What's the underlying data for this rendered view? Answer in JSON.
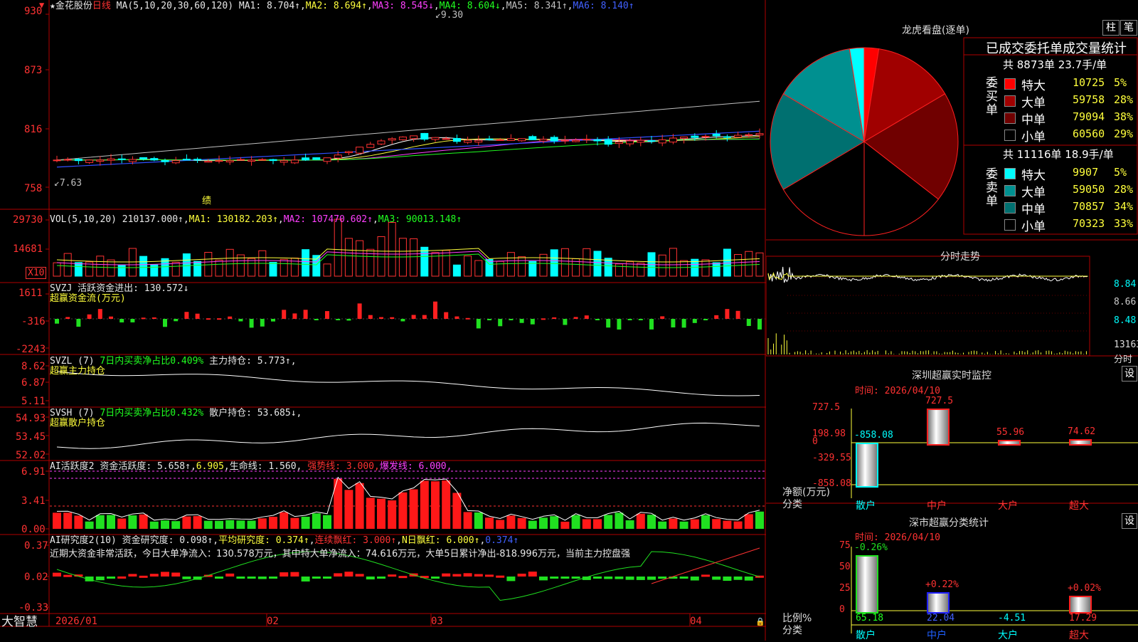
{
  "colors": {
    "up": "#ff3232",
    "down": "#00ffff",
    "ma1": "#ffffff",
    "ma2": "#ffff3c",
    "ma3": "#ff40ff",
    "ma4": "#20ff20",
    "ma5": "#c0c0c0",
    "ma6": "#4060ff",
    "grid": "#c00000"
  },
  "main": {
    "star_title": "★金花股份",
    "period": "日线",
    "ma_params": "MA(5,10,20,30,60,120)",
    "ma1": "MA1: 8.704↑",
    "ma2": "MA2: 8.694↑",
    "ma3": "MA3: 8.545↓",
    "ma4": "MA4: 8.604↓",
    "ma5": "MA5: 8.341↑",
    "ma6": "MA6: 8.140↑",
    "high_mark": "9.30",
    "low_mark": "7.63",
    "event_mark": "绩",
    "yticks": [
      "930",
      "873",
      "816",
      "758"
    ],
    "corner_icon": "arrow-down-icon"
  },
  "vol": {
    "title": "VOL(5,10,20)",
    "val": "210137.000↑",
    "ma1": "MA1: 130182.203↑",
    "ma2": "MA2: 107470.602↑",
    "ma3": "MA3: 90013.148↑",
    "yticks": [
      "29730",
      "14681"
    ],
    "unit": "X10"
  },
  "svzj": {
    "title": "SVZJ",
    "label": "活跃资金进出: 130.572↓",
    "sub": "超赢资金流(万元)",
    "yticks": [
      "1611",
      "-316",
      "-2243"
    ]
  },
  "svzl": {
    "title": "SVZL (7)",
    "label": "7日内买卖净占比0.409%",
    "label2": "主力持仓: 5.773↑,",
    "sub": "超赢主力持仓",
    "yticks": [
      "8.62",
      "6.87",
      "5.11"
    ]
  },
  "svsh": {
    "title": "SVSH (7)",
    "label": "7日内买卖净占比0.432%",
    "label2": "散户持仓: 53.685↓,",
    "sub": "超赢散户持仓",
    "yticks": [
      "54.93",
      "53.45",
      "52.02"
    ]
  },
  "ai1": {
    "title": "AI活跃度2",
    "label": "资金活跃度: 5.658↑",
    "v2": "6.905",
    "label3": "生命线: 1.560,",
    "label4": "强势线: 3.000,",
    "label5": "爆发线: 6.000,",
    "yticks": [
      "6.91",
      "3.41",
      "0.00"
    ]
  },
  "ai2": {
    "title": "AI研究度2(10)",
    "label": "资金研究度: 0.098↑",
    "label2": "平均研究度: 0.374↑",
    "label3": "连续飘红: 3.000↑",
    "label4": "N日飘红: 6.000↑",
    "label5": "0.374↑",
    "note": "近期大资金非常活跃，今日大单净流入：130.578万元，其中特大单净流入：74.616万元，大单5日累计净出-818.996万元，当前主力控盘强",
    "yticks": [
      "0.37",
      "0.02",
      "-0.33"
    ]
  },
  "xaxis": {
    "brand": "大智慧",
    "labels": [
      "2026/01",
      "02",
      "03",
      "04"
    ]
  },
  "dragon": {
    "title": "龙虎看盘(逐单)",
    "btn1": "柱",
    "btn2": "笔",
    "header": "已成交委托单成交量统计",
    "buy_total": "共 8873单 23.7手/单",
    "buy_label": "委买单",
    "buy_rows": [
      {
        "name": "特大",
        "val": "10725",
        "pct": "5%",
        "color": "#ff0000"
      },
      {
        "name": "大单",
        "val": "59758",
        "pct": "28%",
        "color": "#a00000"
      },
      {
        "name": "中单",
        "val": "79094",
        "pct": "38%",
        "color": "#700000"
      },
      {
        "name": "小单",
        "val": "60560",
        "pct": "29%",
        "color": "#000000"
      }
    ],
    "sell_total": "共 11116单 18.9手/单",
    "sell_label": "委卖单",
    "sell_rows": [
      {
        "name": "特大",
        "val": "9907",
        "pct": "5%",
        "color": "#00ffff"
      },
      {
        "name": "大单",
        "val": "59050",
        "pct": "28%",
        "color": "#009090"
      },
      {
        "name": "中单",
        "val": "70857",
        "pct": "34%",
        "color": "#007070"
      },
      {
        "name": "小单",
        "val": "70323",
        "pct": "33%",
        "color": "#000000"
      }
    ],
    "pie": [
      {
        "value": 5,
        "color": "#ff0000"
      },
      {
        "value": 28,
        "color": "#a00000"
      },
      {
        "value": 38,
        "color": "#700000"
      },
      {
        "value": 29,
        "color": "#000000"
      },
      {
        "value": 33,
        "color": "#000000"
      },
      {
        "value": 34,
        "color": "#007070"
      },
      {
        "value": 28,
        "color": "#009090"
      },
      {
        "value": 5,
        "color": "#00ffff"
      }
    ]
  },
  "intraday": {
    "title": "分时走势",
    "yticks": [
      "8.84",
      "8.66",
      "8.48"
    ],
    "vol": "13163",
    "vol_label": "分时"
  },
  "sz_monitor": {
    "title": "深圳超赢实时监控",
    "btn": "设",
    "time": "时间: 2026/04/10",
    "yticks": [
      "727.5",
      "198.98",
      "0",
      "-329.55",
      "-858.08"
    ],
    "ylabel": "净额(万元)",
    "ylabel2": "分类",
    "bars": [
      {
        "label": "散户",
        "value": -858.08,
        "vtxt": "-858.08"
      },
      {
        "label": "中户",
        "value": 727.5,
        "vtxt": "727.5"
      },
      {
        "label": "大户",
        "value": 55.96,
        "vtxt": "55.96"
      },
      {
        "label": "超大",
        "value": 74.62,
        "vtxt": "74.62"
      }
    ]
  },
  "sz_class": {
    "title": "深市超赢分类统计",
    "btn": "设",
    "time": "时间: 2026/04/10",
    "yticks": [
      "75",
      "50",
      "25",
      "0"
    ],
    "ylabel": "比例%",
    "ylabel2": "分类",
    "bars": [
      {
        "label": "散户",
        "value": 65.18,
        "top": "-0.26%",
        "bottom": "65.18"
      },
      {
        "label": "中户",
        "value": 22.04,
        "top": "+0.22%",
        "bottom": "22.04"
      },
      {
        "label": "大户",
        "value": -4.51,
        "top": "",
        "bottom": "-4.51"
      },
      {
        "label": "超大",
        "value": 17.29,
        "top": "+0.02%",
        "bottom": "17.29"
      }
    ]
  }
}
